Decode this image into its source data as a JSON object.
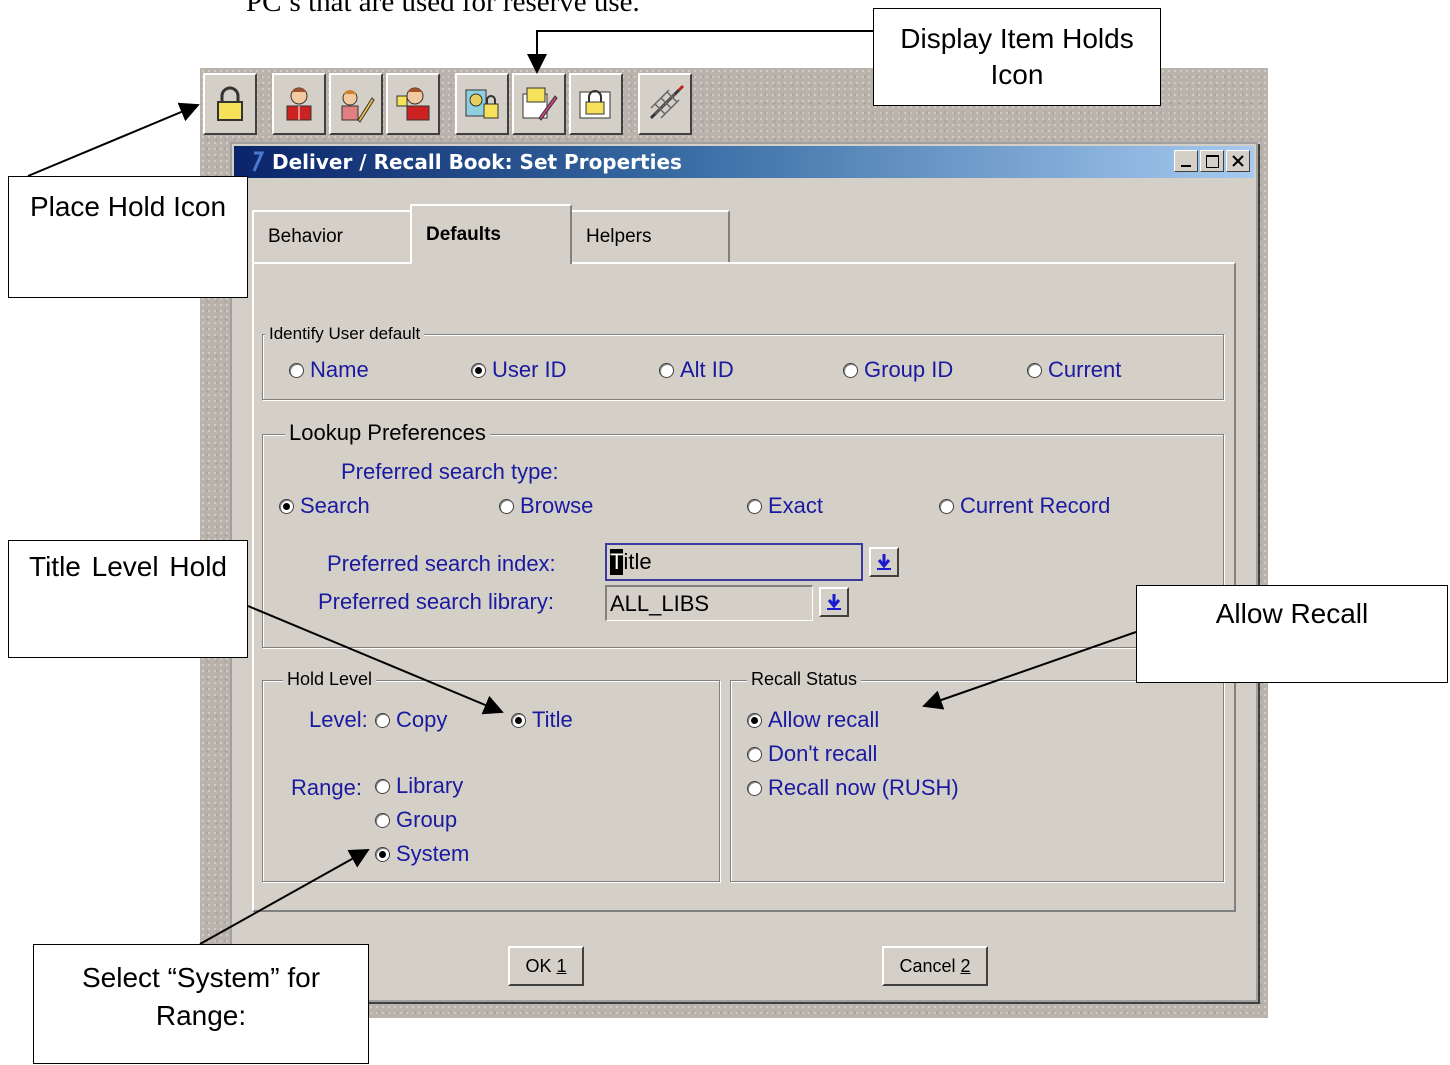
{
  "doc": {
    "top_text": "PC’s that are used for reserve use."
  },
  "toolbar": {
    "buttons": [
      {
        "icon": "place-hold-lock-icon"
      },
      {
        "icon": "user-book-icon"
      },
      {
        "icon": "user-edit-icon"
      },
      {
        "icon": "user-lock-icon"
      },
      {
        "icon": "display-item-holds-icon"
      },
      {
        "icon": "item-edit-icon"
      },
      {
        "icon": "item-lock-icon"
      },
      {
        "icon": "net-icon"
      }
    ]
  },
  "window": {
    "title": "Deliver / Recall Book: Set Properties",
    "title_bar_color": "#0a246a"
  },
  "tabs": [
    {
      "label": "Behavior",
      "active": false
    },
    {
      "label": "Defaults",
      "active": true
    },
    {
      "label": "Helpers",
      "active": false
    }
  ],
  "identify_user": {
    "legend": "Identify User default",
    "options": [
      {
        "label": "Name",
        "selected": false
      },
      {
        "label": "User ID",
        "selected": true
      },
      {
        "label": "Alt ID",
        "selected": false
      },
      {
        "label": "Group ID",
        "selected": false
      },
      {
        "label": "Current",
        "selected": false
      }
    ]
  },
  "lookup": {
    "legend": "Lookup Preferences",
    "search_type_label": "Preferred search type:",
    "search_types": [
      {
        "label": "Search",
        "selected": true
      },
      {
        "label": "Browse",
        "selected": false
      },
      {
        "label": "Exact",
        "selected": false
      },
      {
        "label": "Current Record",
        "selected": false
      }
    ],
    "index_label": "Preferred search index:",
    "index_value_first": "T",
    "index_value_rest": "itle",
    "library_label": "Preferred search library:",
    "library_value": "ALL_LIBS"
  },
  "hold_level": {
    "legend": "Hold Level",
    "level_label": "Level:",
    "level_options": [
      {
        "label": "Copy",
        "selected": false
      },
      {
        "label": "Title",
        "selected": true
      }
    ],
    "range_label": "Range:",
    "range_options": [
      {
        "label": "Library",
        "selected": false
      },
      {
        "label": "Group",
        "selected": false
      },
      {
        "label": "System",
        "selected": true
      }
    ]
  },
  "recall_status": {
    "legend": "Recall Status",
    "options": [
      {
        "label": "Allow recall",
        "selected": true
      },
      {
        "label": "Don't recall",
        "selected": false
      },
      {
        "label": "Recall now (RUSH)",
        "selected": false
      }
    ]
  },
  "buttons": {
    "ok_label": "OK",
    "ok_key": "1",
    "cancel_label": "Cancel",
    "cancel_key": "2"
  },
  "callouts": {
    "display_item_holds": "Display Item Holds Icon",
    "place_hold": "Place Hold Icon",
    "title_level_hold": "Title Level Hold",
    "allow_recall": "Allow Recall",
    "select_system": "Select “System” for Range:"
  }
}
